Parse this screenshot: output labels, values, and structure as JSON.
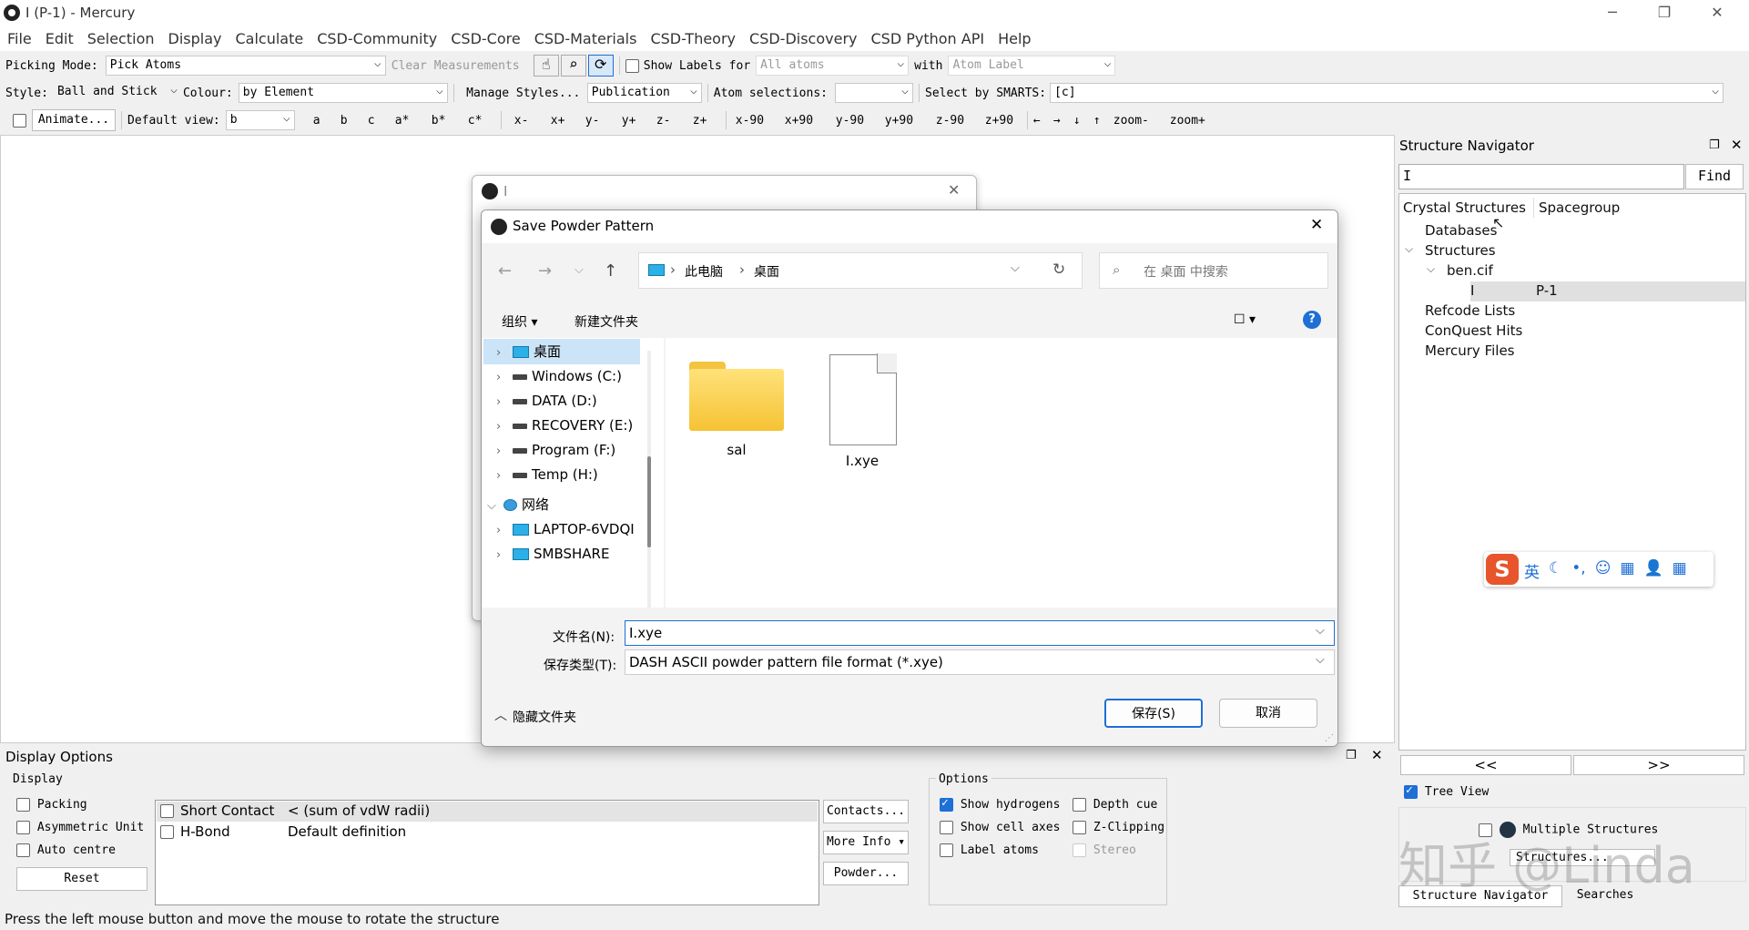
{
  "window": {
    "title": "I (P-1) - Mercury",
    "minimize": "─",
    "restore": "❐",
    "close": "✕"
  },
  "menu": [
    "File",
    "Edit",
    "Selection",
    "Display",
    "Calculate",
    "CSD-Community",
    "CSD-Core",
    "CSD-Materials",
    "CSD-Theory",
    "CSD-Discovery",
    "CSD Python API",
    "Help"
  ],
  "toolbar1": {
    "picking_label": "Picking Mode:",
    "picking_value": "Pick Atoms",
    "clear_measurements": "Clear Measurements",
    "show_labels_label": "Show Labels for",
    "labels_for_value": "All atoms",
    "with_label": "with",
    "with_value": "Atom Label"
  },
  "toolbar2": {
    "style_label": "Style:",
    "style_value": "Ball and Stick",
    "colour_label": "Colour:",
    "colour_value": "by Element",
    "manage_styles": "Manage Styles...",
    "publication": "Publication",
    "atom_sel_label": "Atom selections:",
    "atom_sel_value": "",
    "smarts_label": "Select by SMARTS:",
    "smarts_value": "[c]"
  },
  "toolbar3": {
    "animate": "Animate...",
    "default_view_label": "Default view:",
    "default_view_value": "b",
    "axes": [
      "a",
      "b",
      "c",
      "a*",
      "b*",
      "c*"
    ],
    "moves": [
      "x-",
      "x+",
      "y-",
      "y+",
      "z-",
      "z+"
    ],
    "rotations": [
      "x-90",
      "x+90",
      "y-90",
      "y+90",
      "z-90",
      "z+90"
    ],
    "arrows": [
      "←",
      "→",
      "↓",
      "↑"
    ],
    "zoom_out": "zoom-",
    "zoom_in": "zoom+"
  },
  "bg_dialog": {
    "title": "I",
    "close": "✕"
  },
  "save_dialog": {
    "title": "Save Powder Pattern",
    "close": "✕",
    "back": "←",
    "forward": "→",
    "recent": "⌵",
    "up": "↑",
    "path": [
      "此电脑",
      "桌面"
    ],
    "refresh": "↻",
    "search_placeholder": "在 桌面 中搜索",
    "organize": "组织 ▾",
    "new_folder": "新建文件夹",
    "view_icon": "☐ ▾",
    "help": "?",
    "nav_items": [
      {
        "label": "桌面",
        "type": "desktop",
        "selected": true
      },
      {
        "label": "Windows (C:)",
        "type": "sysdrive"
      },
      {
        "label": "DATA (D:)",
        "type": "drive"
      },
      {
        "label": "RECOVERY (E:)",
        "type": "drive"
      },
      {
        "label": "Program (F:)",
        "type": "drive"
      },
      {
        "label": "Temp (H:)",
        "type": "drive"
      },
      {
        "label": "网络",
        "type": "network",
        "expanded": true
      },
      {
        "label": "LAPTOP-6VDQI",
        "type": "pc"
      },
      {
        "label": "SMBSHARE",
        "type": "pc"
      }
    ],
    "files": [
      {
        "name": "sal",
        "type": "folder"
      },
      {
        "name": "I.xye",
        "type": "file"
      }
    ],
    "filename_label": "文件名(N):",
    "filename_value": "I.xye",
    "filetype_label": "保存类型(T):",
    "filetype_value": "DASH ASCII powder pattern file format (*.xye)",
    "hide_folders": "隐藏文件夹",
    "save": "保存(S)",
    "cancel": "取消"
  },
  "display_options": {
    "title": "Display Options",
    "display_group": "Display",
    "checks": [
      "Packing",
      "Asymmetric Unit",
      "Auto centre"
    ],
    "reset": "Reset",
    "contacts": [
      {
        "name": "Short Contact",
        "definition": "< (sum of vdW radii)"
      },
      {
        "name": "H-Bond",
        "definition": "Default definition"
      }
    ],
    "contacts_btn": "Contacts...",
    "more_info_btn": "More Info ▾",
    "powder_btn": "Powder...",
    "options_group": "Options",
    "options": [
      {
        "label": "Show hydrogens",
        "checked": true
      },
      {
        "label": "Depth cue",
        "checked": false
      },
      {
        "label": "Show cell axes",
        "checked": false
      },
      {
        "label": "Z-Clipping",
        "checked": false
      },
      {
        "label": "Label atoms",
        "checked": false
      },
      {
        "label": "Stereo",
        "checked": false,
        "disabled": true
      }
    ]
  },
  "navigator": {
    "title": "Structure Navigator",
    "search_value": "I",
    "find": "Find",
    "col1": "Crystal Structures",
    "col2": "Spacegroup",
    "tree": {
      "databases": "Databases",
      "structures": "Structures",
      "file": "ben.cif",
      "item": "I",
      "item_sg": "P-1",
      "refcode": "Refcode Lists",
      "conquest": "ConQuest Hits",
      "mercury_files": "Mercury Files"
    },
    "prev": "<<",
    "next": ">>",
    "tree_view": "Tree View",
    "multiple": "Multiple Structures",
    "structures_btn": "Structures...",
    "tabs": [
      "Structure Navigator",
      "Searches"
    ]
  },
  "ime": {
    "logo": "S",
    "items": [
      "英",
      "☾",
      "•,",
      "☺",
      "▦",
      "👤",
      "▦"
    ]
  },
  "watermark": "知乎 @Linda",
  "status": "Press the left mouse button and move the mouse to rotate the structure"
}
